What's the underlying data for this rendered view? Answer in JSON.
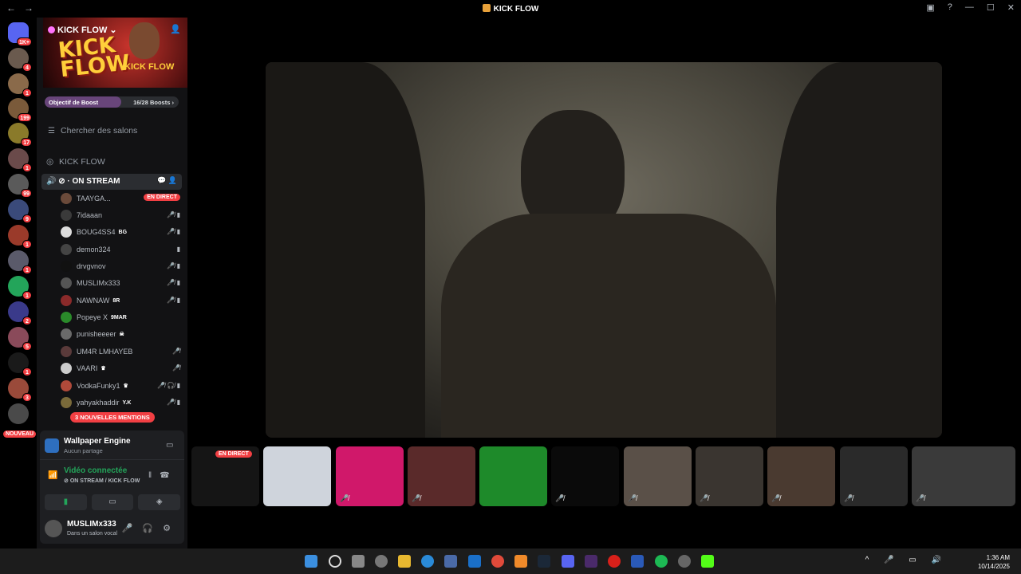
{
  "titlebar": {
    "title": "KICK FLOW"
  },
  "guilds": [
    {
      "badge": "1K+"
    },
    {
      "badge": "4"
    },
    {
      "badge": "1"
    },
    {
      "badge": "199"
    },
    {
      "badge": "17"
    },
    {
      "badge": "1"
    },
    {
      "badge": "99"
    },
    {
      "badge": "9"
    },
    {
      "badge": "1"
    },
    {
      "badge": "1"
    },
    {
      "badge": "1"
    },
    {
      "badge": "2"
    },
    {
      "badge": "5"
    },
    {
      "badge": "1"
    },
    {
      "badge": "3"
    }
  ],
  "guilds_new_label": "NOUVEAU",
  "server": {
    "name": "KICK FLOW",
    "banner_title": "KICK FLOW",
    "banner_sub": "KICK FLOW",
    "boost_goal": "Objectif de Boost",
    "boost_count": "16/28 Boosts",
    "boost_progress": 0.57,
    "search": "Chercher des salons",
    "category": "KICK FLOW"
  },
  "voice_channel": {
    "name": "ON STREAM",
    "members": [
      {
        "name": "TAAYGA...",
        "live": "EN DIRECT"
      },
      {
        "name": "7idaaan"
      },
      {
        "name": "BOUG4SS4",
        "tag": "BG"
      },
      {
        "name": "demon324"
      },
      {
        "name": "drvgvnov"
      },
      {
        "name": "MUSLIMx333"
      },
      {
        "name": "NAWNAW",
        "tag": "8R"
      },
      {
        "name": "Popeye X",
        "tag": "9MAR"
      },
      {
        "name": "punisheeeer"
      },
      {
        "name": "UM4R LMHAYEB"
      },
      {
        "name": "VAARI"
      },
      {
        "name": "VodkaFunky1"
      },
      {
        "name": "yahyakhaddir",
        "tag": "Y.K"
      }
    ],
    "mentions": "3 NOUVELLES MENTIONS"
  },
  "activity": {
    "title": "Wallpaper Engine",
    "subtitle": "Aucun partage"
  },
  "connection": {
    "status": "Vidéo connectée",
    "location": "ON STREAM / KICK FLOW"
  },
  "user": {
    "name": "MUSLIMx333",
    "status": "Dans un salon vocal"
  },
  "strip": {
    "live_label": "EN DIRECT"
  },
  "clock": {
    "time": "1:36 AM",
    "date": "10/14/2025"
  },
  "colors": {
    "accent": "#5865f2",
    "live": "#f23f43",
    "connected": "#23a55a"
  }
}
